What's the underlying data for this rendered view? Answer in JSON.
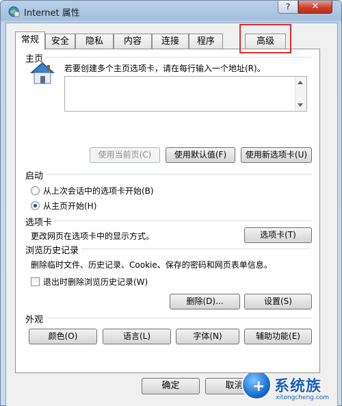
{
  "window": {
    "title": "Internet 属性",
    "help_label": "?",
    "close_label": "✕"
  },
  "tabs": [
    {
      "label": "常规"
    },
    {
      "label": "安全"
    },
    {
      "label": "隐私"
    },
    {
      "label": "内容"
    },
    {
      "label": "连接"
    },
    {
      "label": "程序"
    },
    {
      "label": "高级"
    }
  ],
  "home_page": {
    "group_title": "主页",
    "instruction": "若要创建多个主页选项卡，请在每行输入一个地址(R)。",
    "address_value": "",
    "use_current_label": "使用当前页(C)",
    "use_default_label": "使用默认值(F)",
    "use_new_tab_label": "使用新选项卡(U)"
  },
  "startup": {
    "group_title": "启动",
    "option_last_session": "从上次会话中的选项卡开始(B)",
    "option_home_page": "从主页开始(H)",
    "selected": "option_home_page"
  },
  "tabs_section": {
    "group_title": "选项卡",
    "description": "更改网页在选项卡中的显示方式。",
    "tabs_button_label": "选项卡(T)"
  },
  "history": {
    "group_title": "浏览历史记录",
    "description": "删除临时文件、历史记录、Cookie、保存的密码和网页表单信息。",
    "delete_on_exit_label": "退出时删除浏览历史记录(W)",
    "delete_on_exit_checked": false,
    "delete_button_label": "删除(D)...",
    "settings_button_label": "设置(S)"
  },
  "appearance": {
    "group_title": "外观",
    "colors_label": "颜色(O)",
    "languages_label": "语言(L)",
    "fonts_label": "字体(N)",
    "accessibility_label": "辅助功能(E)"
  },
  "footer": {
    "ok_label": "确定",
    "cancel_label": "取消"
  },
  "watermark": {
    "title": "系统族",
    "url": "xitongcheng.com"
  },
  "colors": {
    "highlight": "#e02b2b",
    "radio_dot": "#1e4f86",
    "close_button": "#c9402b"
  }
}
